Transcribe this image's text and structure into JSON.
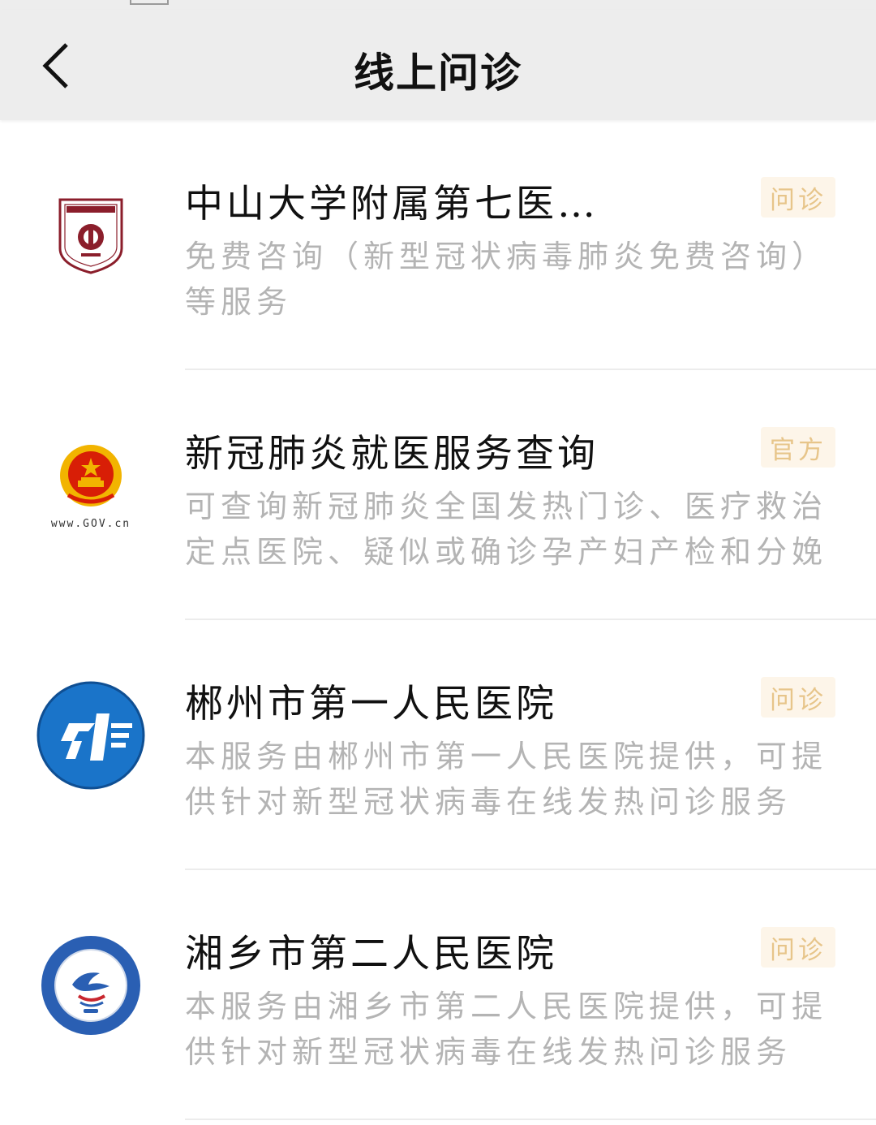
{
  "header": {
    "title": "线上问诊",
    "back_icon": "chevron-left-icon"
  },
  "colors": {
    "header_bg": "#ededed",
    "tag_bg": "#fdf5e9",
    "tag_text": "#e7c58a",
    "desc_text": "#b4b4b4"
  },
  "items": [
    {
      "logo": "sysu-seventh-hospital-logo",
      "name": "中山大学附属第七医…",
      "tag": "问诊",
      "desc": "免费咨询（新型冠状病毒肺炎免费咨询）等服务"
    },
    {
      "logo": "gov-emblem-logo",
      "logo_caption": "www.GOV.cn",
      "name": "新冠肺炎就医服务查询",
      "tag": "官方",
      "desc": "可查询新冠肺炎全国发热门诊、医疗救治定点医院、疑似或确诊孕产妇产检和分娩定…"
    },
    {
      "logo": "chenzhou-first-hospital-logo",
      "name": "郴州市第一人民医院",
      "tag": "问诊",
      "desc": "本服务由郴州市第一人民医院提供，可提供针对新型冠状病毒在线发热问诊服务"
    },
    {
      "logo": "xiangxiang-second-hospital-logo",
      "name": "湘乡市第二人民医院",
      "tag": "问诊",
      "desc": "本服务由湘乡市第二人民医院提供，可提供针对新型冠状病毒在线发热问诊服务"
    }
  ]
}
